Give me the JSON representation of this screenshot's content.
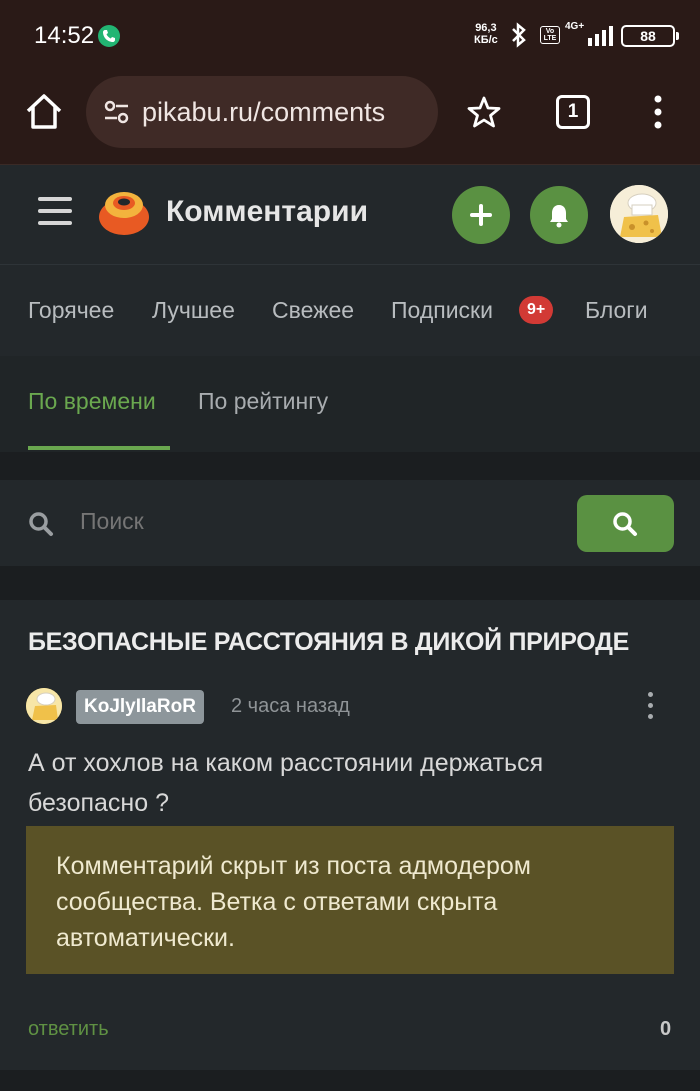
{
  "status_bar": {
    "time": "14:52",
    "net_speed_value": "96,3",
    "net_speed_unit": "КБ/с",
    "volte": "Vo LTE",
    "network": "4G+",
    "battery": "88"
  },
  "browser": {
    "url": "pikabu.ru/comments",
    "tab_count": "1"
  },
  "header": {
    "title": "Комментарии"
  },
  "nav_tabs": [
    {
      "label": "Горячее"
    },
    {
      "label": "Лучшее"
    },
    {
      "label": "Свежее"
    },
    {
      "label": "Подписки",
      "badge": "9+"
    },
    {
      "label": "Блоги"
    }
  ],
  "sort_tabs": {
    "active": "По времени",
    "other": "По рейтингу"
  },
  "search": {
    "placeholder": "Поиск"
  },
  "post": {
    "title": "БЕЗОПАСНЫЕ РАССТОЯНИЯ В ДИКОЙ ПРИРОДЕ",
    "comment": {
      "username": "KoJlyIlaRoR",
      "time": "2 часа назад",
      "text": "А от хохлов на каком расстоянии держаться безопасно ?",
      "hidden_notice": "Комментарий скрыт из поста адмодером сообщества. Ветка с ответами скрыта автоматически.",
      "reply_label": "ответить",
      "rating": "0"
    }
  },
  "colors": {
    "accent_green": "#5a9142",
    "badge_red": "#d23a35",
    "hidden_box": "#5a5226"
  }
}
